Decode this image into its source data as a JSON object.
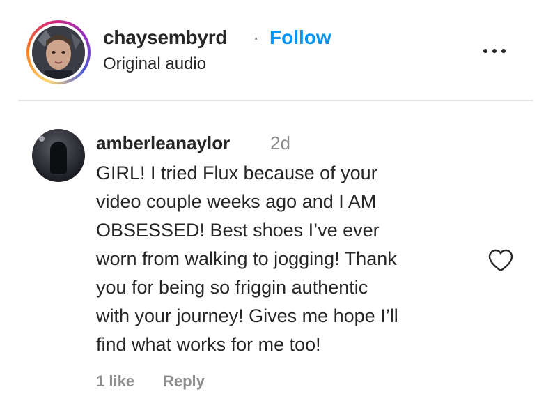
{
  "post": {
    "username": "chaysembyrd",
    "separator": "·",
    "follow_label": "Follow",
    "audio_label": "Original audio",
    "more_icon": "more-horizontal-icon"
  },
  "comment": {
    "author": "amberleanaylor",
    "time": "2d",
    "lines": [
      "GIRL! I tried Flux because of your",
      "video couple weeks ago and I AM",
      "OBSESSED! Best shoes I’ve ever",
      "worn from walking to jogging! Thank",
      "you for being so friggin authentic",
      "with your journey! Gives me hope I’ll",
      "find what works for me too!"
    ],
    "likes": "1 like",
    "reply_label": "Reply",
    "like_icon": "heart-outline-icon"
  },
  "colors": {
    "link": "#0095f6",
    "text": "#262626",
    "muted": "#8e8e8e",
    "divider": "#e3e3e3"
  }
}
